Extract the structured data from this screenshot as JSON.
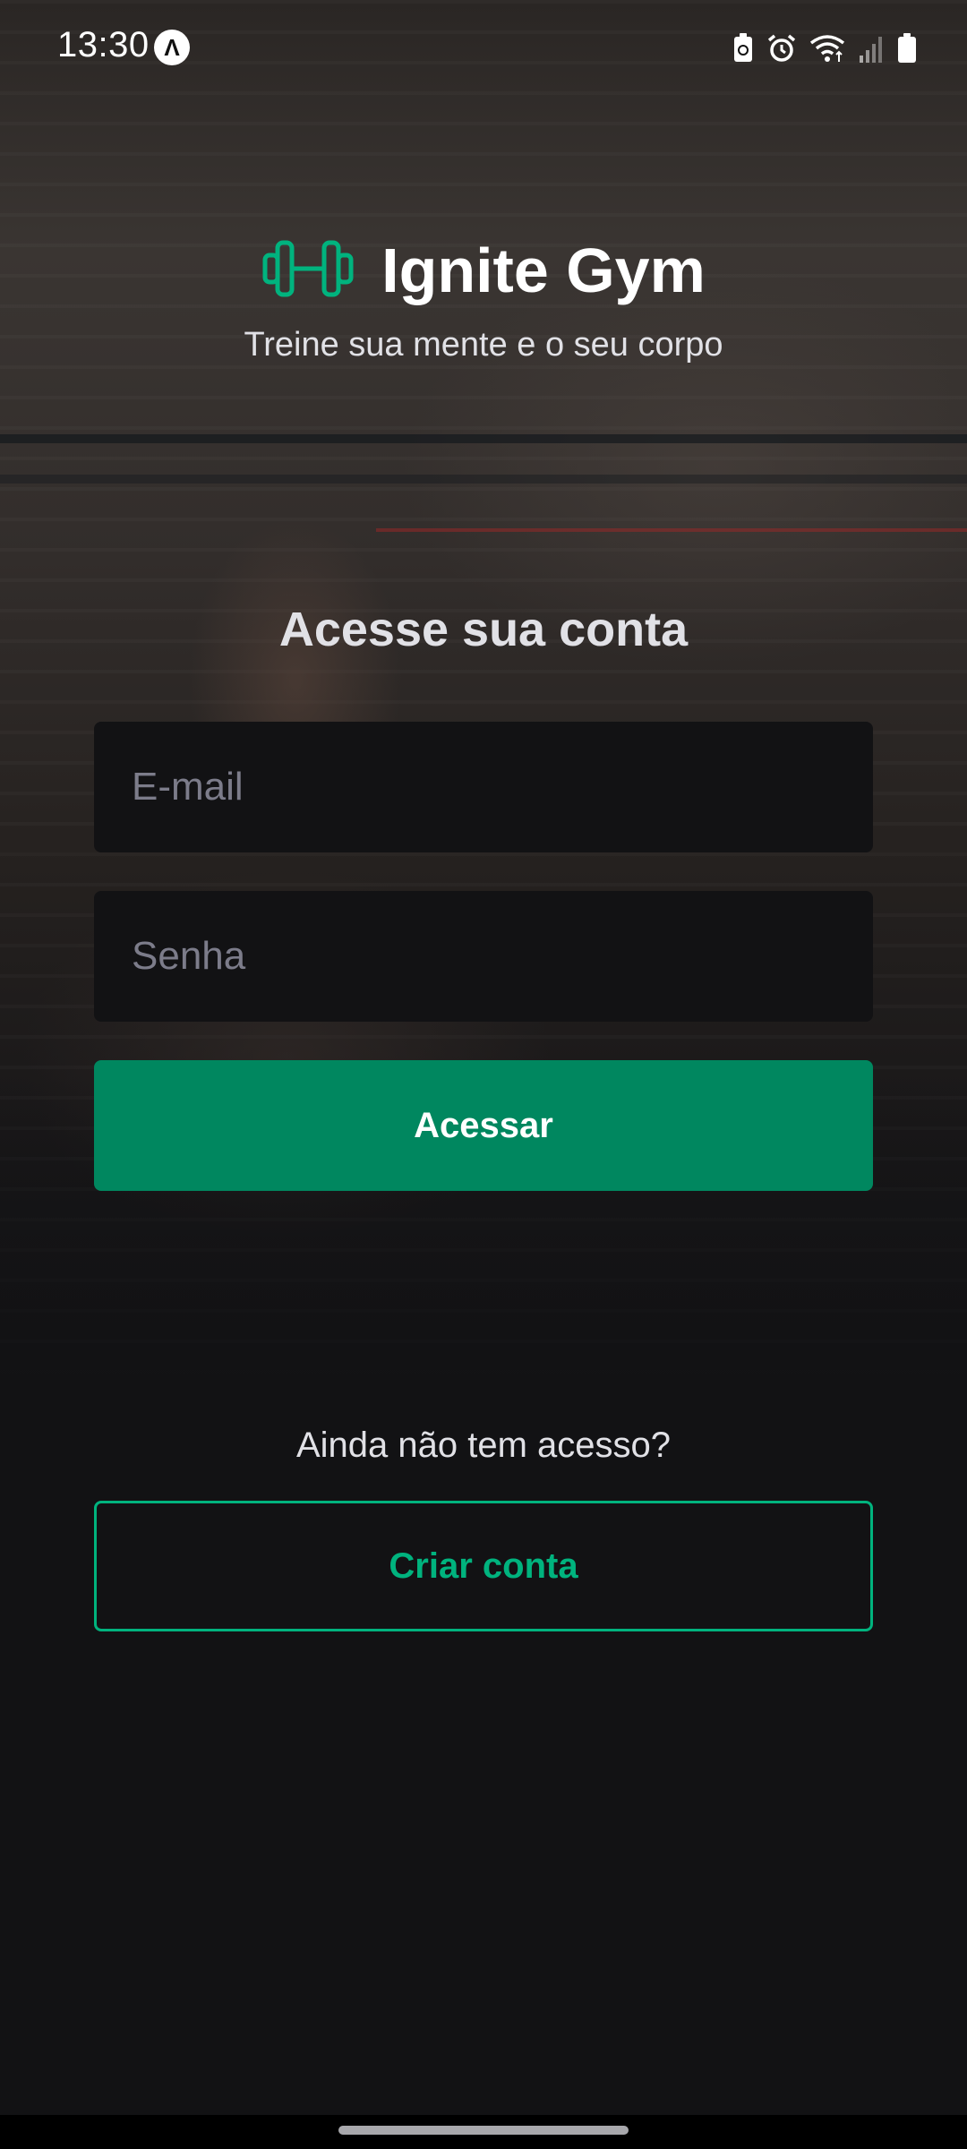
{
  "status_bar": {
    "time": "13:30",
    "app_icon_glyph": "Λ",
    "icons": [
      "recycle-battery-icon",
      "alarm-icon",
      "wifi-icon",
      "signal-icon",
      "battery-icon"
    ]
  },
  "header": {
    "logo_icon": "dumbbell-icon",
    "title": "Ignite Gym",
    "tagline": "Treine sua mente e o seu corpo"
  },
  "login_form": {
    "title": "Acesse sua conta",
    "email": {
      "value": "",
      "placeholder": "E-mail"
    },
    "password": {
      "value": "",
      "placeholder": "Senha"
    },
    "submit_label": "Acessar"
  },
  "signup": {
    "prompt": "Ainda não tem acesso?",
    "button_label": "Criar conta"
  },
  "colors": {
    "background": "#121214",
    "primary_green": "#00875F",
    "accent_green": "#00B37E",
    "input_bg": "#121214",
    "text_light": "#E1E1E6",
    "placeholder": "#7C7C8A"
  }
}
